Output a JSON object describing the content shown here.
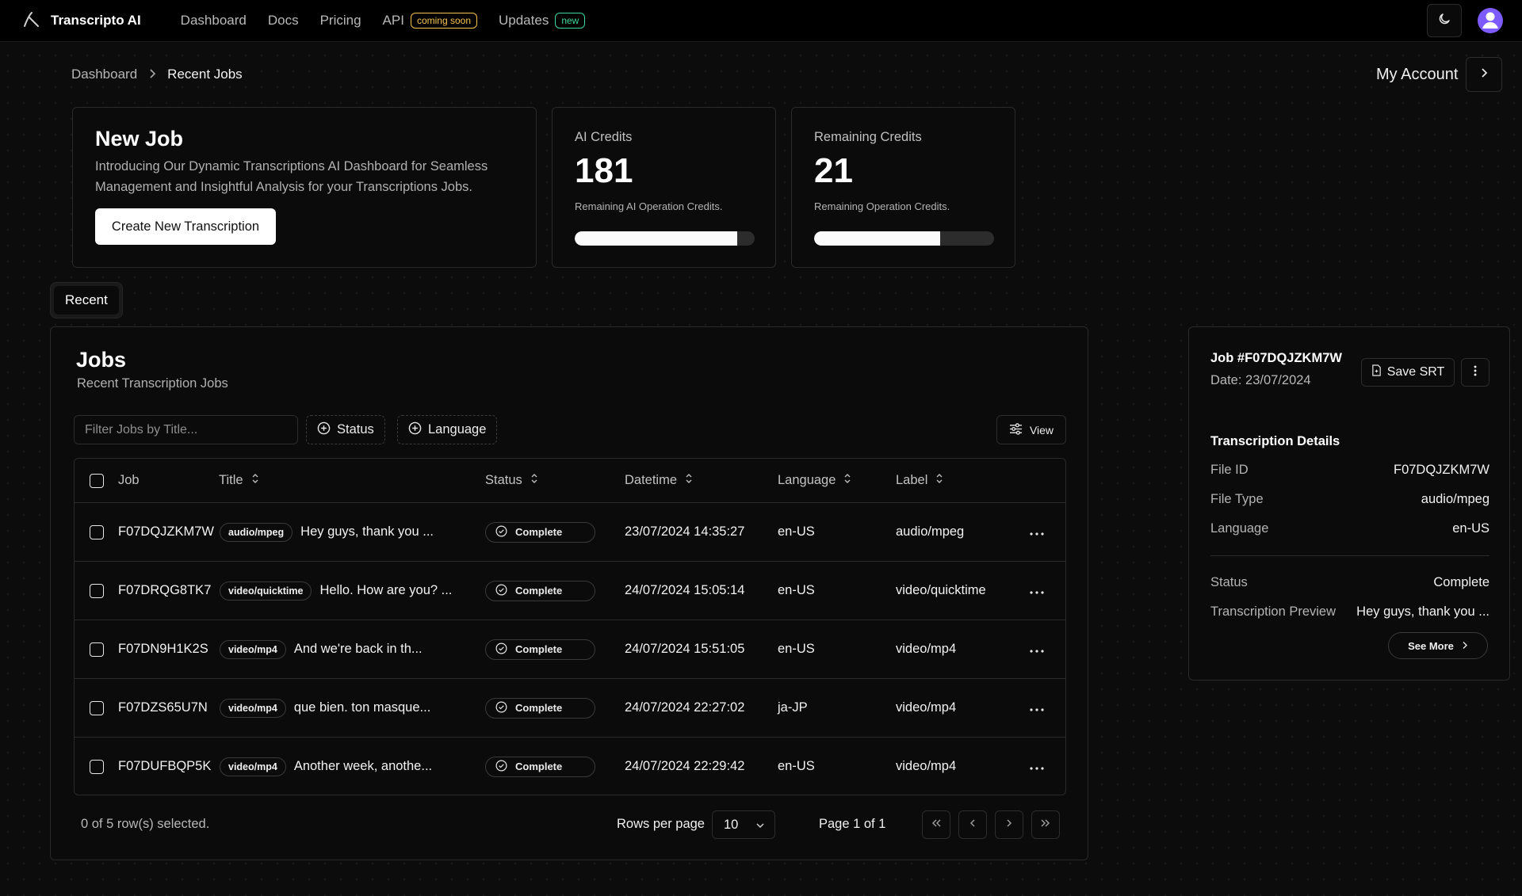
{
  "nav": {
    "brand": "Transcripto AI",
    "links": [
      {
        "label": "Dashboard"
      },
      {
        "label": "Docs"
      },
      {
        "label": "Pricing"
      },
      {
        "label": "API",
        "badge": "coming soon"
      },
      {
        "label": "Updates",
        "badge": "new"
      }
    ]
  },
  "breadcrumb": {
    "root": "Dashboard",
    "current": "Recent Jobs"
  },
  "account": {
    "label": "My Account"
  },
  "new_job": {
    "title": "New Job",
    "description": "Introducing Our Dynamic Transcriptions AI Dashboard for Seamless Management and Insightful Analysis for your Transcriptions Jobs.",
    "button": "Create New Transcription"
  },
  "credits": [
    {
      "title": "AI Credits",
      "value": "181",
      "subtitle": "Remaining AI Operation Credits.",
      "fill_fraction": 0.905
    },
    {
      "title": "Remaining Credits",
      "value": "21",
      "subtitle": "Remaining Operation Credits.",
      "fill_fraction": 0.7
    }
  ],
  "tabs": {
    "active": "Recent"
  },
  "jobs": {
    "title": "Jobs",
    "subtitle": "Recent Transcription Jobs",
    "filter_placeholder": "Filter Jobs by Title...",
    "status_filter": "Status",
    "language_filter": "Language",
    "view": "View",
    "columns": {
      "job": "Job",
      "title": "Title",
      "status": "Status",
      "datetime": "Datetime",
      "language": "Language",
      "label": "Label"
    },
    "rows": [
      {
        "job": "F07DQJZKM7W",
        "tag": "audio/mpeg",
        "title": "Hey guys, thank you ...",
        "status": "Complete",
        "datetime": "23/07/2024 14:35:27",
        "language": "en-US",
        "label": "audio/mpeg"
      },
      {
        "job": "F07DRQG8TK7",
        "tag": "video/quicktime",
        "title": "Hello. How are you? ...",
        "status": "Complete",
        "datetime": "24/07/2024 15:05:14",
        "language": "en-US",
        "label": "video/quicktime"
      },
      {
        "job": "F07DN9H1K2S",
        "tag": "video/mp4",
        "title": "And we're back in th...",
        "status": "Complete",
        "datetime": "24/07/2024 15:51:05",
        "language": "en-US",
        "label": "video/mp4"
      },
      {
        "job": "F07DZS65U7N",
        "tag": "video/mp4",
        "title": "que bien. ton masque...",
        "status": "Complete",
        "datetime": "24/07/2024 22:27:02",
        "language": "ja-JP",
        "label": "video/mp4"
      },
      {
        "job": "F07DUFBQP5K",
        "tag": "video/mp4",
        "title": "Another week, anothe...",
        "status": "Complete",
        "datetime": "24/07/2024 22:29:42",
        "language": "en-US",
        "label": "video/mp4"
      }
    ],
    "selection": "0 of 5 row(s) selected.",
    "rows_per_page_label": "Rows per page",
    "rows_per_page": "10",
    "page_info": "Page 1 of 1"
  },
  "detail": {
    "job": "Job #F07DQJZKM7W",
    "date": "Date: 23/07/2024",
    "save": "Save SRT",
    "heading": "Transcription Details",
    "fields": [
      {
        "key": "File ID",
        "value": "F07DQJZKM7W"
      },
      {
        "key": "File Type",
        "value": "audio/mpeg"
      },
      {
        "key": "Language",
        "value": "en-US"
      },
      {
        "key": "Status",
        "value": "Complete"
      },
      {
        "key": "Transcription Preview",
        "value": "Hey guys, thank you ..."
      }
    ],
    "see_more": "See More"
  }
}
